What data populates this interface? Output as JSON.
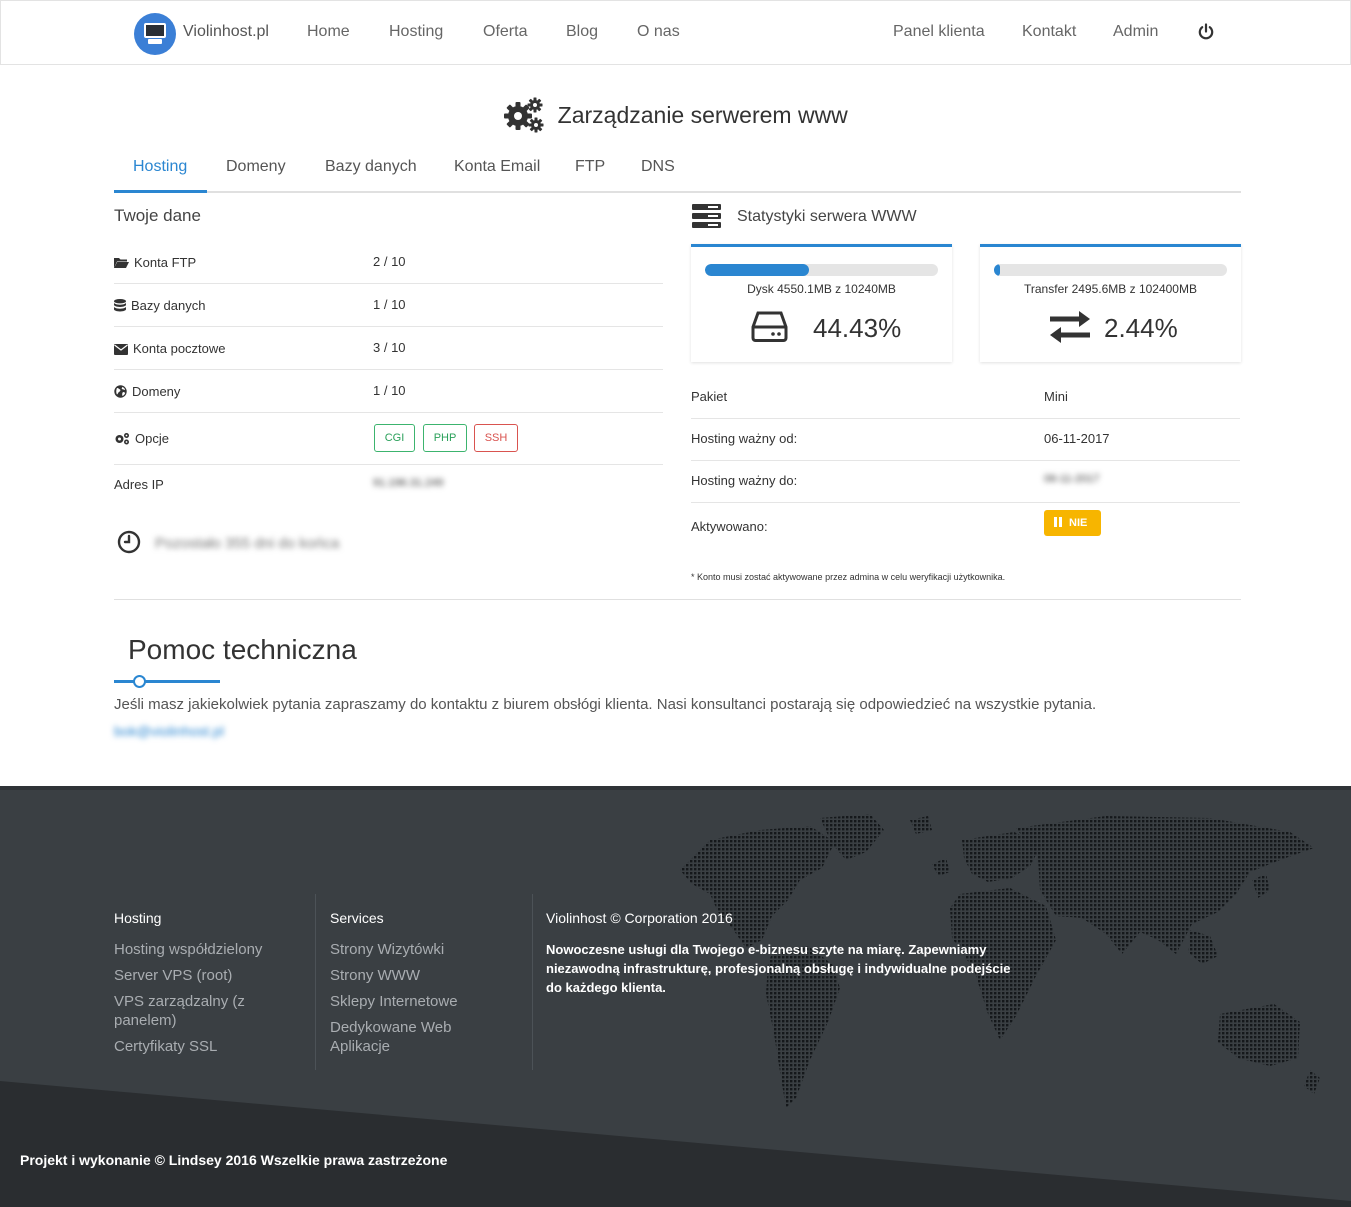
{
  "navbar": {
    "brand": "Violinhost.pl",
    "left_links": [
      "Home",
      "Hosting",
      "Oferta",
      "Blog",
      "O nas"
    ],
    "right_links": [
      "Panel klienta",
      "Kontakt",
      "Admin"
    ]
  },
  "page": {
    "title": "Zarządzanie serwerem www"
  },
  "tabs": [
    "Hosting",
    "Domeny",
    "Bazy danych",
    "Konta Email",
    "FTP",
    "DNS"
  ],
  "your_data": {
    "title": "Twoje dane",
    "rows": [
      {
        "label": "Konta FTP",
        "value": "2 / 10"
      },
      {
        "label": "Bazy danych",
        "value": "1 / 10"
      },
      {
        "label": "Konta pocztowe",
        "value": "3 / 10"
      },
      {
        "label": "Domeny",
        "value": "1 / 10"
      }
    ],
    "options_label": "Opcje",
    "options": [
      "CGI",
      "PHP",
      "SSH"
    ],
    "ip_label": "Adres IP",
    "ip_value": "91.196.31.249",
    "remaining": "Pozostało 355 dni do końca"
  },
  "stats": {
    "title": "Statystyki serwera WWW",
    "disk": {
      "caption": "Dysk 4550.1MB z 10240MB",
      "percent": "44.43%",
      "fill": 0.4443
    },
    "transfer": {
      "caption": "Transfer 2495.6MB z 102400MB",
      "percent": "2.44%",
      "fill": 0.0244
    },
    "rows": [
      {
        "label": "Pakiet",
        "value": "Mini"
      },
      {
        "label": "Hosting ważny od:",
        "value": "06-11-2017"
      },
      {
        "label": "Hosting ważny do:",
        "value": "06-11-2017"
      }
    ],
    "activated_label": "Aktywowano:",
    "activated_value": "NIE",
    "note": "* Konto musi zostać aktywowane przez admina w celu weryfikacji użytkownika."
  },
  "help": {
    "title": "Pomoc techniczna",
    "text": "Jeśli masz jakiekolwiek pytania zapraszamy do kontaktu z biurem obsłógi klienta. Nasi konsultanci postarają się odpowiedzieć na wszystkie pytania.",
    "email": "bok@violinhost.pl"
  },
  "footer": {
    "col1": {
      "title": "Hosting",
      "links": [
        "Hosting współdzielony",
        "Server VPS (root)",
        "VPS zarządzalny (z panelem)",
        "Certyfikaty SSL"
      ]
    },
    "col2": {
      "title": "Services",
      "links": [
        "Strony Wizytówki",
        "Strony WWW",
        "Sklepy Internetowe",
        "Dedykowane Web Aplikacje"
      ]
    },
    "col3": {
      "title": "Violinhost © Corporation 2016",
      "text": "Nowoczesne usługi dla Twojego e-biznesu szyte na miarę. Zapewniamy niezawodną infrastrukturę, profesjonalną obsługę i indywidualne podejście do każdego klienta."
    },
    "copyright": "Projekt i wykonanie © Lindsey 2016 Wszelkie prawa zastrzeżone"
  },
  "colors": {
    "accent": "#2a86d1",
    "success": "#2aa05a",
    "danger": "#d9534f",
    "warning": "#f7b500",
    "footer": "#3a3f43",
    "footer_dark": "#2a2d30"
  }
}
